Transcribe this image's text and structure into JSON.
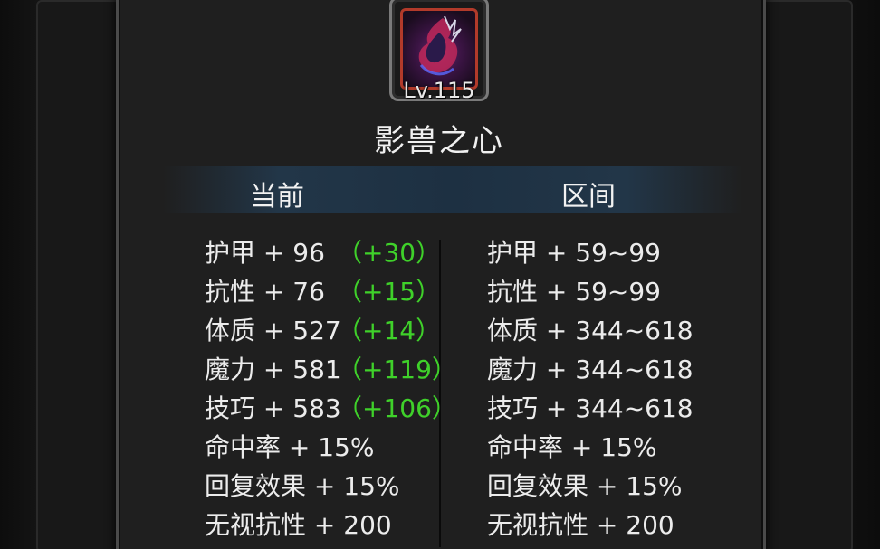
{
  "item": {
    "level": "Lv.115",
    "name": "影兽之心",
    "icon": "shadow-beast-heart-icon"
  },
  "headers": {
    "current": "当前",
    "range": "区间"
  },
  "current_stats": [
    {
      "text": "护甲 + 96",
      "bonus": "（+30）"
    },
    {
      "text": "抗性 + 76",
      "bonus": "（+15）"
    },
    {
      "text": "体质 + 527",
      "bonus": "（+14）"
    },
    {
      "text": "魔力 + 581",
      "bonus": "（+119）"
    },
    {
      "text": "技巧 + 583",
      "bonus": "（+106）"
    },
    {
      "text": "命中率 + 15%",
      "bonus": ""
    },
    {
      "text": "回复效果 + 15%",
      "bonus": ""
    },
    {
      "text": "无视抗性 + 200",
      "bonus": ""
    }
  ],
  "range_stats": [
    "护甲 + 59~99",
    "抗性 + 59~99",
    "体质 + 344~618",
    "魔力 + 344~618",
    "技巧 + 344~618",
    "命中率 + 15%",
    "回复效果 + 15%",
    "无视抗性 + 200"
  ],
  "colors": {
    "bonus": "#3fd12a",
    "text": "#ececec",
    "icon_border": "#b23a2a"
  }
}
